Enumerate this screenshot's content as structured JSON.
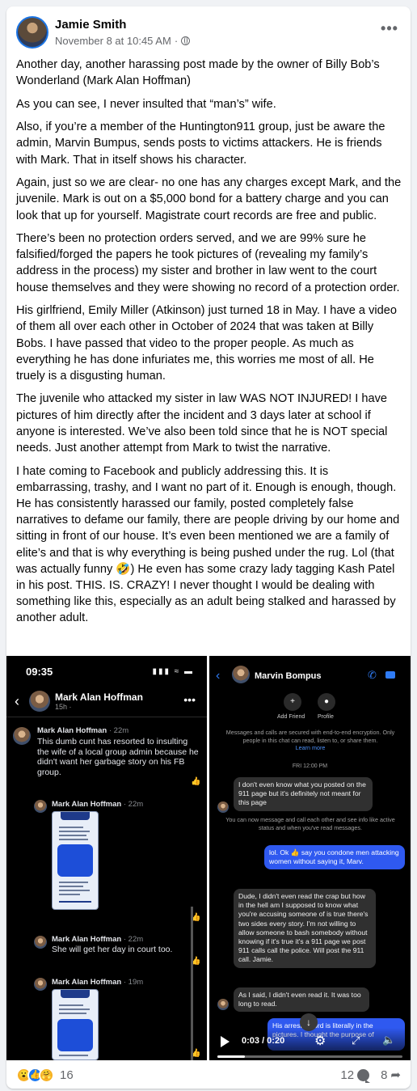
{
  "post": {
    "author": "Jamie Smith",
    "timestamp": "November 8 at 10:45 AM",
    "separator": "·",
    "paragraphs": [
      "Another day, another harassing post made by the owner of Billy Bob’s Wonderland (Mark Alan Hoffman)",
      "As you can see, I never insulted that “man’s” wife.",
      "Also, if you’re a member of the Huntington911 group, just be aware the admin, Marvin Bumpus, sends posts to victims attackers. He is friends with Mark. That in itself shows his character.",
      "Again, just so we are clear- no one has any charges except Mark, and the juvenile. Mark is out on a $5,000 bond for a battery charge and you can look that up for yourself. Magistrate court records are free and public.",
      "There’s been no protection orders served, and we are 99% sure he falsified/forged the papers he took pictures of (revealing my family’s address in the process) my sister and brother in law went to the court house themselves and they were showing no record of a protection order.",
      "His girlfriend, Emily Miller (Atkinson) just turned 18 in May. I have a video of them all over each other in October of 2024 that was taken at Billy Bobs. I have passed that video to the proper people. As much as everything he has done infuriates me, this worries me most of all. He truely is a disgusting human.",
      "The juvenile who attacked my sister in law WAS NOT INJURED! I have pictures of him directly after the incident and 3 days later at school if anyone is interested. We’ve also been told since that he is NOT special needs. Just another attempt from Mark to twist the narrative.",
      "I hate coming to Facebook and publicly addressing this. It is embarrassing, trashy, and I want no part of it. Enough is enough, though. He has consistently harassed our family, posted completely false narratives to defame our family, there are people driving by our home and sitting in front of our house. It’s even been mentioned we are a family of elite’s and that is why everything is being pushed under the rug. Lol (that was actually funny 🤣) He even has some crazy lady tagging Kash Patel in his post. THIS. IS. CRAZY! I never thought I would be dealing with something like this, especially as an adult being stalked and harassed by another adult."
    ],
    "more_icon": "more-horizontal-icon",
    "privacy_icon": "globe-icon"
  },
  "left_shot": {
    "time": "09:35",
    "status_icons": "▮▮▮ ≈ ▬",
    "header_name": "Mark Alan Hoffman",
    "header_sub": "15h ·",
    "comments": [
      {
        "name": "Mark Alan Hoffman",
        "time": "· 22m",
        "text": "This dumb cunt  has resorted to insulting the wife of a local group admin because he didn't want her garbage story on his FB group."
      },
      {
        "name": "Mark Alan Hoffman",
        "time": "· 22m",
        "text": ""
      },
      {
        "name": "Mark Alan Hoffman",
        "time": "· 22m",
        "text": "She will get her day in court too."
      },
      {
        "name": "Mark Alan Hoffman",
        "time": "· 19m",
        "text": ""
      }
    ]
  },
  "right_shot": {
    "header_name": "Marvin Bompus",
    "add_friend": "Add Friend",
    "profile": "Profile",
    "encryption_note": "Messages and calls are secured with end-to-end encryption. Only people in this chat can read, listen to, or share them.",
    "learn_more": "Learn more",
    "date": "FRI 12:00 PM",
    "msg1": "I don't even know what you posted on the 911 page but it's definitely not meant for this page",
    "system_note": "You can now message and call each other and see info like active status and when you've read messages.",
    "msg2": "lol. Ok 👍 say you condone men attacking women without saying it, Marv.",
    "msg3": "Dude, I didn't even read the crap but how in the hell am I supposed to know what you're accusing someone of is true there's two sides every story. I'm not willing to allow someone to bash somebody without knowing if it's true it's a 911 page we post 911 calls call the police. Will post the 911 call. Jamie.",
    "msg4": "As I said, I didn't even read it. It was too long to read.",
    "msg5": "His arrest record is literally in the pictures. I thought the purpose of",
    "video_time": "0:03 / 0:20",
    "video_progress": 0.15
  },
  "footer": {
    "reaction_count": "16",
    "comment_count": "12",
    "share_count": "8",
    "reactions": [
      "😮",
      "👍",
      "🤗"
    ]
  }
}
